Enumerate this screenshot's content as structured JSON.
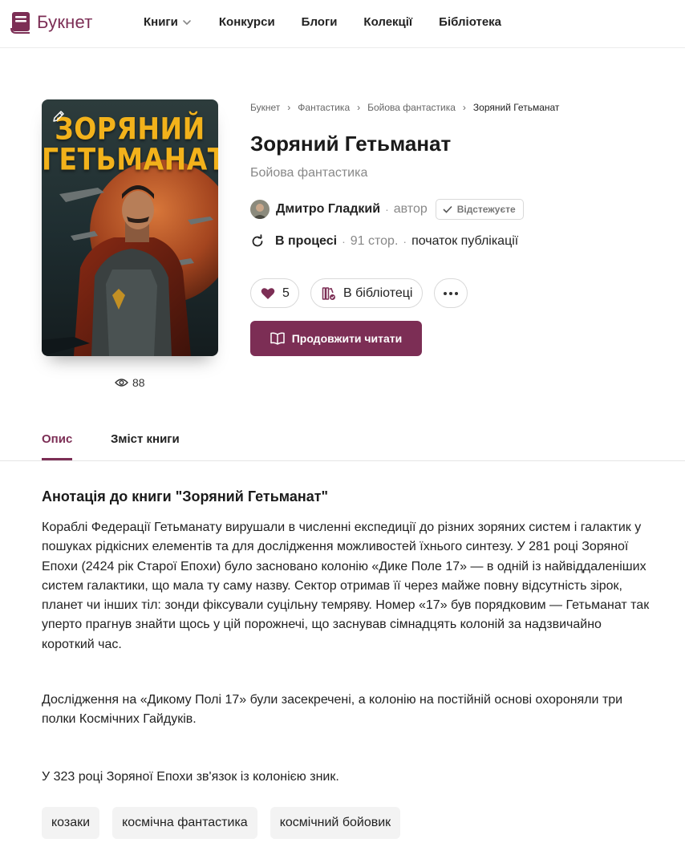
{
  "header": {
    "logo_text": "Букнет",
    "nav": [
      {
        "label": "Книги",
        "has_dropdown": true
      },
      {
        "label": "Конкурси"
      },
      {
        "label": "Блоги"
      },
      {
        "label": "Колекції"
      },
      {
        "label": "Бібліотека"
      }
    ]
  },
  "colors": {
    "accent": "#7c2e55",
    "cover_title": "#f2b21b"
  },
  "book": {
    "cover_title_line1": "ЗОРЯНИЙ",
    "cover_title_line2": "ГЕТЬМАНАТ",
    "views": "88",
    "breadcrumb": [
      "Букнет",
      "Фантастика",
      "Бойова фантастика",
      "Зоряний Гетьманат"
    ],
    "title": "Зоряний Гетьманат",
    "genre": "Бойова фантастика",
    "author": {
      "name": "Дмитро Гладкий",
      "role": "автор",
      "follow_label": "Відстежуєте"
    },
    "status": {
      "state": "В процесі",
      "pages": "91 стор.",
      "publication": "початок публікації"
    },
    "likes": "5",
    "library_label": "В бібліотеці",
    "read_label": "Продовжити читати"
  },
  "tabs": [
    "Опис",
    "Зміст книги"
  ],
  "description": {
    "title": "Анотація до книги \"Зоряний Гетьманат\"",
    "paragraphs": [
      "Кораблі Федерації Гетьманату вирушали в численні експедиції до різних зоряних систем і галактик у пошуках рідкісних елементів та для дослідження можливостей їхнього синтезу. У 281 році Зоряної Епохи (2424 рік Старої Епохи) було засновано колонію «Дике Поле 17» — в одній із найвіддаленіших систем галактики, що мала ту саму назву. Сектор отримав її через майже повну відсутність зірок, планет чи інших тіл: зонди фіксували суцільну темряву. Номер «17» був порядковим — Гетьманат так уперто прагнув знайти щось у цій порожнечі, що заснував сімнадцять колоній за надзвичайно короткий час.",
      "Дослідження на «Дикому Полі 17» були засекречені, а колонію на постійній основі охороняли три полки Космічних Гайдуків.",
      "У 323 році Зоряної Епохи зв'язок із колонією зник."
    ]
  },
  "tags": [
    "козаки",
    "космічна фантастика",
    "космічний бойовик"
  ]
}
